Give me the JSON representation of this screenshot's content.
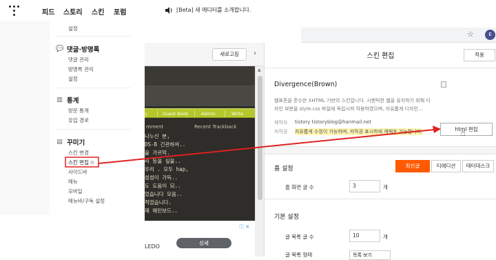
{
  "nav": {
    "items": [
      "피드",
      "스토리",
      "스킨",
      "포럼"
    ],
    "notice": "[Beta] 새 에디터를 소개합니다."
  },
  "sidebar": {
    "top_item": "설정",
    "sections": [
      {
        "title": "댓글·방명록",
        "icon": "speech-bubble-icon",
        "items": [
          "댓글 관리",
          "방명록 관리",
          "설정"
        ]
      },
      {
        "title": "통계",
        "icon": "bar-chart-icon",
        "items": [
          "방문 통계",
          "유입 경로"
        ]
      },
      {
        "title": "꾸미기",
        "icon": "document-icon",
        "items": [
          "스킨 변경",
          "스킨 편집",
          "사이드바",
          "메뉴",
          "모바일",
          "메뉴바/구독 설정"
        ]
      }
    ],
    "highlighted_item": "스킨 편집"
  },
  "browser": {
    "profile_initial": "E"
  },
  "preview": {
    "refresh_label": "새로고침",
    "menu": [
      "Guest Book",
      "Admin",
      "Write"
    ],
    "headings": [
      "mment",
      "Recent Trackback"
    ],
    "rows": [
      "나누신 분,",
      "DS-B 긴관하여..",
      "을 가르막.",
      "리 등을 싶을..",
      "우리 . 모두 hap,",
      "성성이 가득..",
      "도 도움이 되..",
      "었습니다 모음..",
      "적었습니다.",
      "제 에민보드.."
    ]
  },
  "ad": {
    "text": "LEDO",
    "button_label": "상세"
  },
  "panel": {
    "title": "스킨 편집",
    "apply_label": "적용",
    "skin_name": "Divergence(Brown)",
    "description": "웹표준을 준수한 XHTML 기반의 스킨입니다. 시멘틱한 웹을 유지하기 위해 디자인 부분을 style.css 파일에 독립시켜 작용하였으며, 자유롭게 디자인…",
    "maker_key": "제작자",
    "maker_value": "tistory  tistoryblog@hanmail.net",
    "copyright_key": "저작권",
    "copyright_value": "자유롭게 수정이 가능하며, 저작권 표시하에 재배포 가능합니다.",
    "html_button": "html 편집",
    "home_section": "홈 설정",
    "tabs": [
      "최신글",
      "티에디션",
      "태터데스크"
    ],
    "home_count_label": "홈 화면 글 수",
    "home_count_value": "3",
    "unit": "개",
    "basic_section": "기본 설정",
    "list_count_label": "글 목록 글 수",
    "list_count_value": "10",
    "list_type_label": "글 목록 형태",
    "list_type_value": "목록 보기"
  }
}
